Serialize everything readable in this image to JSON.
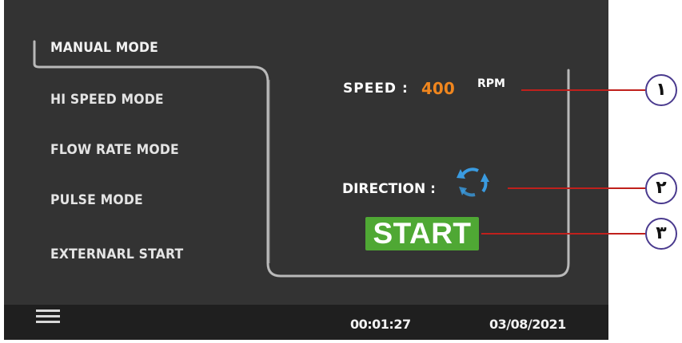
{
  "menu": {
    "items": [
      {
        "label": "MANUAL MODE",
        "active": true
      },
      {
        "label": "HI SPEED MODE",
        "active": false
      },
      {
        "label": "FLOW RATE MODE",
        "active": false
      },
      {
        "label": "PULSE MODE",
        "active": false
      },
      {
        "label": "EXTERNARL START",
        "active": false
      }
    ]
  },
  "main": {
    "speed_label": "SPEED :",
    "speed_value": "400",
    "speed_unit": "RPM",
    "direction_label": "DIRECTION :",
    "direction_icon": "rotate-direction-icon",
    "start_label": "START"
  },
  "footer": {
    "menu_icon": "hamburger-menu-icon",
    "time": "00:01:27",
    "date": "03/08/2021"
  },
  "callouts": [
    "١",
    "٢",
    "٣"
  ],
  "colors": {
    "background": "#333333",
    "speed_value": "#f0861e",
    "start_button": "#4fa834",
    "leader_line": "#c0201c",
    "callout_border": "#4a3a8e",
    "direction_icon": "#3a9be0"
  }
}
